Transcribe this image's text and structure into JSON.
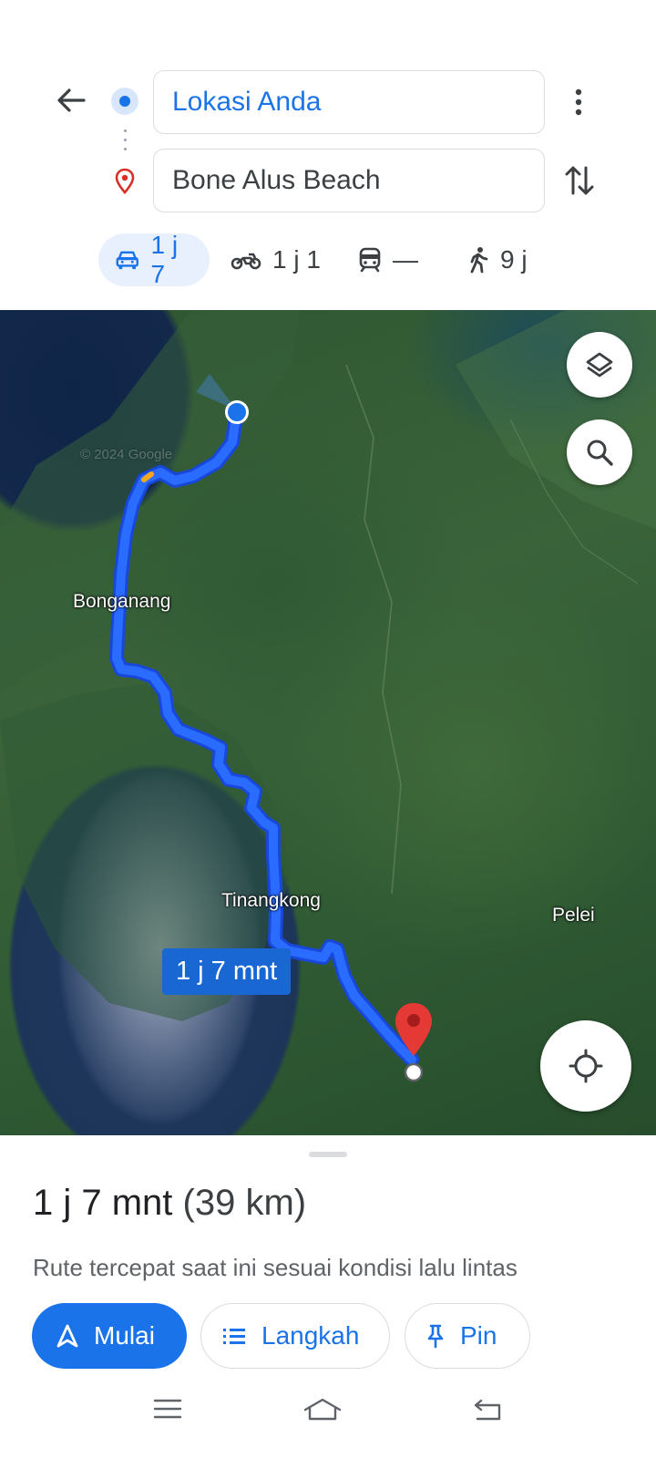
{
  "search": {
    "origin_value": "Lokasi Anda",
    "destination_value": "Bone Alus Beach"
  },
  "modes": [
    {
      "name": "car",
      "icon": "car-icon",
      "label": "1 j 7",
      "active": true
    },
    {
      "name": "motorcycle",
      "icon": "motorcycle-icon",
      "label": "1 j 1",
      "active": false
    },
    {
      "name": "transit",
      "icon": "train-icon",
      "label": "—",
      "active": false
    },
    {
      "name": "walking",
      "icon": "walking-icon",
      "label": "9 j",
      "active": false
    }
  ],
  "map": {
    "places": {
      "bonganang": "Bonganang",
      "tinangkong": "Tinangkong",
      "pelei": "Pelei"
    },
    "eta_label": "1 j 7 mnt",
    "watermark": "© 2024 Google"
  },
  "sheet": {
    "duration": "1 j 7 mnt",
    "distance": "(39 km)",
    "description": "Rute tercepat saat ini sesuai kondisi lalu lintas",
    "start_label": "Mulai",
    "steps_label": "Langkah",
    "pin_label": "Pin"
  },
  "colors": {
    "accent": "#1a73e8",
    "route": "#1a5bff",
    "destination_marker": "#e53935"
  }
}
